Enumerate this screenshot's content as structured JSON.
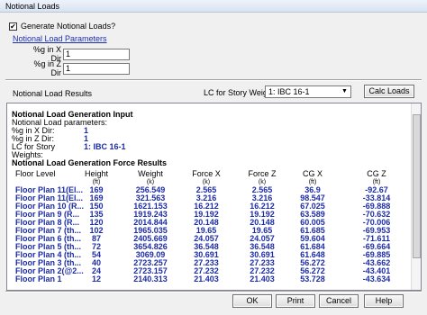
{
  "window": {
    "title": "Notional Loads"
  },
  "generate": {
    "label": "Generate Notional Loads?",
    "checked": "✔"
  },
  "params": {
    "title": "Notional Load Parameters",
    "x_label": "%g in X Dir",
    "x_value": "1",
    "z_label": "%g in Z Dir",
    "z_value": "1"
  },
  "results": {
    "label": "Notional Load Results",
    "lc_label": "LC for Story Weights",
    "lc_value": "1: IBC 16-1",
    "calc_button": "Calc Loads"
  },
  "report": {
    "input_title": "Notional Load Generation Input",
    "input_params": "Notional Load parameters:",
    "x_dir_label": "%g in X Dir:",
    "x_dir_value": "1",
    "z_dir_label": "%g in Z Dir:",
    "z_dir_value": "1",
    "lc_label": "LC for Story Weights:",
    "lc_value": "1: IBC 16-1",
    "force_title": "Notional Load Generation Force Results",
    "headers": [
      "Floor Level",
      "Height",
      "Weight",
      "Force X",
      "Force Z",
      "CG X",
      "CG Z"
    ],
    "units": [
      "",
      "(ft)",
      "(k)",
      "(k)",
      "(k)",
      "(ft)",
      "(ft)"
    ],
    "rows": [
      [
        "Floor Plan 11(El...",
        "169",
        "256.549",
        "2.565",
        "2.565",
        "36.9",
        "-92.67"
      ],
      [
        "Floor Plan 11(El...",
        "169",
        "321.563",
        "3.216",
        "3.216",
        "98.547",
        "-33.814"
      ],
      [
        "Floor Plan 10 (R...",
        "150",
        "1621.153",
        "16.212",
        "16.212",
        "67.025",
        "-69.888"
      ],
      [
        "Floor Plan 9 (R...",
        "135",
        "1919.243",
        "19.192",
        "19.192",
        "63.589",
        "-70.632"
      ],
      [
        "Floor Plan 8 (R...",
        "120",
        "2014.844",
        "20.148",
        "20.148",
        "60.005",
        "-70.006"
      ],
      [
        "Floor Plan 7 (th...",
        "102",
        "1965.035",
        "19.65",
        "19.65",
        "61.685",
        "-69.953"
      ],
      [
        "Floor Plan 6 (th...",
        "87",
        "2405.669",
        "24.057",
        "24.057",
        "59.604",
        "-71.611"
      ],
      [
        "Floor Plan 5 (th...",
        "72",
        "3654.826",
        "36.548",
        "36.548",
        "61.684",
        "-69.664"
      ],
      [
        "Floor Plan 4 (th...",
        "54",
        "3069.09",
        "30.691",
        "30.691",
        "61.648",
        "-69.885"
      ],
      [
        "Floor Plan 3 (th...",
        "40",
        "2723.257",
        "27.233",
        "27.233",
        "56.272",
        "-43.662"
      ],
      [
        "Floor Plan 2(@2...",
        "24",
        "2723.157",
        "27.232",
        "27.232",
        "56.272",
        "-43.401"
      ],
      [
        "Floor Plan 1",
        "12",
        "2140.313",
        "21.403",
        "21.403",
        "53.728",
        "-43.634"
      ]
    ]
  },
  "buttons": {
    "ok": "OK",
    "print": "Print",
    "cancel": "Cancel",
    "help": "Help"
  }
}
